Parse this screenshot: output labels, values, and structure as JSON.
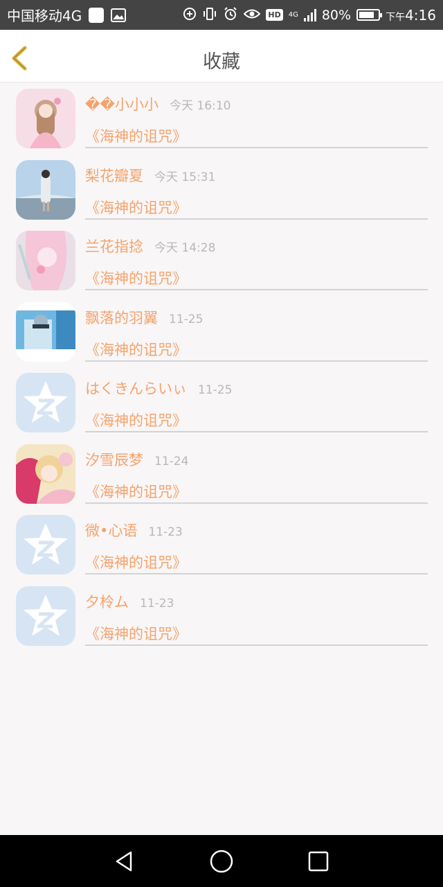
{
  "status_bar": {
    "carrier": "中国移动4G",
    "battery": "80%",
    "battery_level": 0.8,
    "time_prefix": "下午",
    "time": "4:16",
    "hd": "HD",
    "network": "4G",
    "icons": [
      "square-icon",
      "image-icon",
      "data-saver-icon",
      "vibrate-icon",
      "alarm-icon",
      "eye-icon",
      "hd-icon",
      "signal-icon",
      "battery-icon"
    ]
  },
  "header": {
    "title": "收藏",
    "back_icon": "chevron-left-icon",
    "accent": "#d9b13a"
  },
  "colors": {
    "name": "#f5a36b",
    "time": "#b8b8b8",
    "divider": "#d3d3d3",
    "background": "#f8f6f7"
  },
  "favorites": [
    {
      "name": "��小小小",
      "time": "今天 16:10",
      "book": "《海神的诅咒》",
      "avatar": "avatar-pink-girl"
    },
    {
      "name": "梨花瓣夏",
      "time": "今天 15:31",
      "book": "《海神的诅咒》",
      "avatar": "avatar-girl-sky"
    },
    {
      "name": "兰花指捻",
      "time": "今天 14:28",
      "book": "《海神的诅咒》",
      "avatar": "avatar-anime-pink"
    },
    {
      "name": "飘落的羽翼",
      "time": "11-25",
      "book": "《海神的诅咒》",
      "avatar": "avatar-anime-blue"
    },
    {
      "name": "はくきんらいぃ",
      "time": "11-25",
      "book": "《海神的诅咒》",
      "avatar": "avatar-default-qq"
    },
    {
      "name": "汐雪辰梦",
      "time": "11-24",
      "book": "《海神的诅咒》",
      "avatar": "avatar-anime-blonde"
    },
    {
      "name": "微•心语",
      "time": "11-23",
      "book": "《海神的诅咒》",
      "avatar": "avatar-default-qq"
    },
    {
      "name": "夕柃ム",
      "time": "11-23",
      "book": "《海神的诅咒》",
      "avatar": "avatar-default-qq"
    }
  ],
  "nav": {
    "icons": [
      "back-triangle-icon",
      "home-circle-icon",
      "recents-square-icon"
    ]
  }
}
